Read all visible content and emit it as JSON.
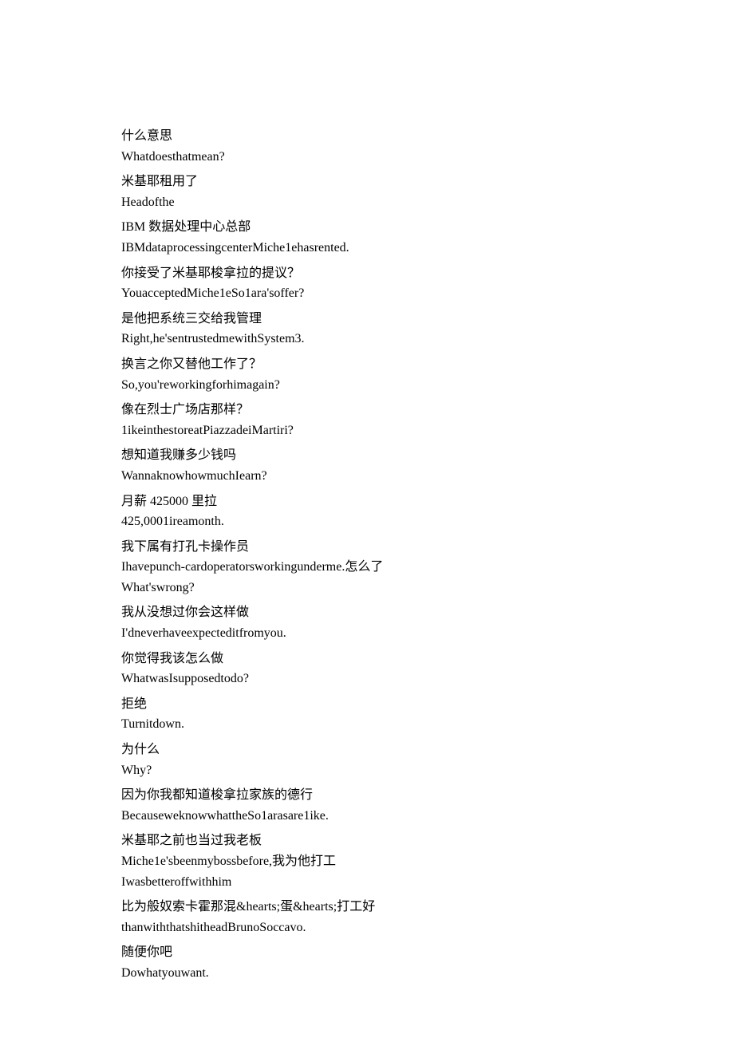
{
  "blocks": [
    [
      "什么意思",
      "Whatdoesthatmean?"
    ],
    [
      "米基耶租用了",
      "Headofthe"
    ],
    [
      "IBM 数据处理中心总部",
      "IBMdataprocessingcenterMiche1ehasrented."
    ],
    [
      "你接受了米基耶梭拿拉的提议？",
      "YouacceptedMiche1eSo1ara'soffer?"
    ],
    [
      "是他把系统三交给我管理",
      "Right,he'sentrustedmewithSystem3."
    ],
    [
      "换言之你又替他工作了？",
      "So,you'reworkingforhimagain?"
    ],
    [
      "像在烈士广场店那样？",
      "1ikeinthestoreatPiazzadeiMartiri?"
    ],
    [
      "想知道我赚多少钱吗",
      "WannaknowhowmuchIearn?"
    ],
    [
      "月薪 425000 里拉",
      "425,0001ireamonth."
    ],
    [
      "我下属有打孔卡操作员",
      "Ihavepunch-cardoperatorsworkingunderme.怎么了",
      "What'swrong?"
    ],
    [
      "我从没想过你会这样做",
      "I'dneverhaveexpecteditfromyou."
    ],
    [
      "你觉得我该怎么做",
      "WhatwasIsupposedtodo?"
    ],
    [
      "拒绝",
      "Turnitdown."
    ],
    [
      "为什么",
      "Why?"
    ],
    [
      "因为你我都知道梭拿拉家族的德行",
      "BecauseweknowwhattheSo1arasare1ike."
    ],
    [
      "米基耶之前也当过我老板",
      "Miche1e'sbeenmybossbefore,我为他打工",
      "Iwasbetteroffwithhim"
    ],
    [
      "比为般奴索卡霍那混&hearts;蛋&hearts;打工好",
      "thanwiththatshitheadBrunoSoccavo."
    ],
    [
      "随便你吧",
      "Dowhatyouwant."
    ]
  ]
}
